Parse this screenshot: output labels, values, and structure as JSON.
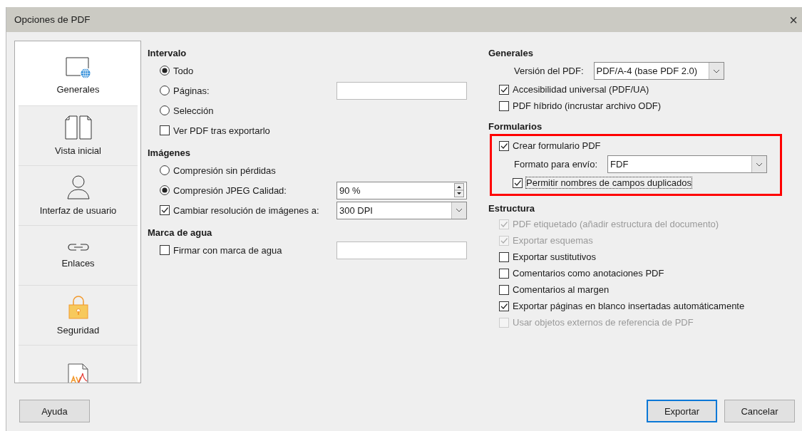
{
  "window": {
    "title": "Opciones de PDF",
    "close": "×"
  },
  "sidebar": {
    "items": [
      {
        "kind": "generales",
        "label": "Generales",
        "selected": true
      },
      {
        "kind": "vista",
        "label": "Vista inicial",
        "selected": false
      },
      {
        "kind": "interfaz",
        "label": "Interfaz de usuario",
        "selected": false
      },
      {
        "kind": "enlaces",
        "label": "Enlaces",
        "selected": false
      },
      {
        "kind": "seguridad",
        "label": "Seguridad",
        "selected": false
      },
      {
        "kind": "firma",
        "selected": false
      }
    ]
  },
  "left": [
    {
      "heading": "Intervalo",
      "items": [
        {
          "kind": "radio",
          "label": "Todo",
          "selected": true
        },
        {
          "kind": "radio-field",
          "label": "Páginas:",
          "selected": false
        },
        {
          "kind": "radio",
          "label": "Selección",
          "selected": false
        },
        {
          "kind": "checkbox",
          "label": "Ver PDF tras exportarlo",
          "checked": false
        }
      ]
    },
    {
      "heading": "Imágenes",
      "items": [
        {
          "kind": "radio",
          "label": "Compresión sin pérdidas",
          "selected": false
        },
        {
          "kind": "radio-spin",
          "label": "Compresión JPEG  Calidad:",
          "selected": true,
          "value": "90 %"
        },
        {
          "kind": "checkbox-select",
          "label": "Cambiar resolución de imágenes a:",
          "checked": true,
          "value": "300 DPI"
        }
      ]
    },
    {
      "heading": "Marca de agua",
      "items": [
        {
          "kind": "checkbox-field",
          "label": "Firmar con marca de agua",
          "checked": false
        }
      ]
    }
  ],
  "right": [
    {
      "heading": "Generales",
      "highlighted": false,
      "items": [
        {
          "kind": "select",
          "label": "Versión del PDF:",
          "value": "PDF/A-4 (base PDF 2.0)"
        },
        {
          "kind": "checkbox",
          "label": "Accesibilidad universal (PDF/UA)",
          "checked": true,
          "disabled": false,
          "focused": false
        },
        {
          "kind": "checkbox",
          "label": "PDF híbrido (incrustar archivo ODF)",
          "checked": false,
          "disabled": false,
          "focused": false
        }
      ]
    },
    {
      "heading": "Formularios",
      "highlighted": true,
      "items": [
        {
          "kind": "checkbox",
          "label": "Crear formulario PDF",
          "checked": true,
          "disabled": false,
          "focused": false
        },
        {
          "kind": "select",
          "label": "Formato para envío:",
          "value": "FDF"
        },
        {
          "kind": "checkbox",
          "label": "Permitir nombres de campos duplicados",
          "checked": true,
          "disabled": false,
          "focused": true,
          "indented": true
        }
      ]
    },
    {
      "heading": "Estructura",
      "highlighted": false,
      "items": [
        {
          "kind": "checkbox",
          "label": "PDF etiquetado (añadir estructura del documento)",
          "checked": true,
          "disabled": true,
          "focused": false
        },
        {
          "kind": "checkbox",
          "label": "Exportar esquemas",
          "checked": true,
          "disabled": true,
          "focused": false
        },
        {
          "kind": "checkbox",
          "label": "Exportar sustitutivos",
          "checked": false,
          "disabled": false,
          "focused": false
        },
        {
          "kind": "checkbox",
          "label": "Comentarios como anotaciones PDF",
          "checked": false,
          "disabled": false,
          "focused": false
        },
        {
          "kind": "checkbox",
          "label": "Comentarios al margen",
          "checked": false,
          "disabled": false,
          "focused": false
        },
        {
          "kind": "checkbox",
          "label": "Exportar páginas en blanco insertadas automáticamente",
          "checked": true,
          "disabled": false,
          "focused": false
        },
        {
          "kind": "checkbox",
          "label": "Usar objetos externos de referencia de PDF",
          "checked": false,
          "disabled": true,
          "focused": false
        }
      ]
    }
  ],
  "buttons": [
    {
      "kind": "help",
      "label": "Ayuda"
    },
    {
      "kind": "default",
      "label": "Exportar"
    },
    {
      "kind": "normal",
      "label": "Cancelar"
    }
  ]
}
